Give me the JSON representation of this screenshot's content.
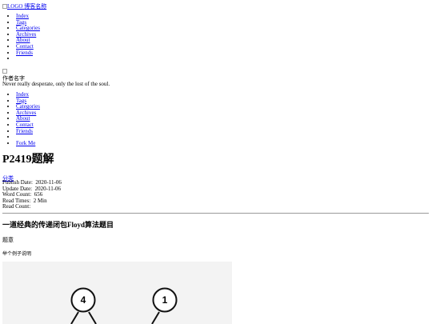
{
  "header": {
    "logo_alt": "LOGO",
    "logo_text": "博客名称",
    "nav": [
      "Index",
      "Tags",
      "Categories",
      "Archives",
      "About",
      "Contact",
      "Friends",
      ""
    ]
  },
  "sidebar": {
    "author": "作者名字",
    "motto": "Never really desperate, only the lost of the soul.",
    "nav": [
      "Index",
      "Tags",
      "Categories",
      "Archives",
      "About",
      "Contact",
      "Friends",
      ""
    ],
    "fork": "Fork Me"
  },
  "post": {
    "title": "P2419题解",
    "category": "分类",
    "meta": [
      {
        "label": "Publish Date:",
        "value": "2020-11-06"
      },
      {
        "label": "Update Date:",
        "value": "2020-11-06"
      },
      {
        "label": "Word Count:",
        "value": "656"
      },
      {
        "label": "Read Times:",
        "value": "2 Min"
      },
      {
        "label": "Read Count:",
        "value": ""
      }
    ],
    "heading": "一道经典的传递闭包Floyd算法题目",
    "p1": "题意",
    "p2": "举个例子说明",
    "figure": {
      "nodes": [
        "4",
        "1"
      ]
    }
  }
}
